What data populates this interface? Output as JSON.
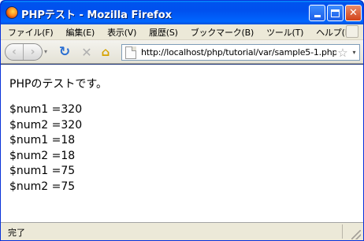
{
  "window": {
    "title": "PHPテスト - Mozilla Firefox",
    "minimize_glyph": "",
    "maximize_glyph": "",
    "close_glyph": "✕"
  },
  "menu": {
    "items": [
      "ファイル(F)",
      "編集(E)",
      "表示(V)",
      "履歴(S)",
      "ブックマーク(B)",
      "ツール(T)",
      "ヘルプ(H)"
    ]
  },
  "toolbar": {
    "back_glyph": "‹",
    "forward_glyph": "›",
    "history_drop_glyph": "▾",
    "reload_glyph": "↻",
    "stop_glyph": "✕",
    "home_glyph": "⌂",
    "url": "http://localhost/php/tutorial/var/sample5-1.php",
    "star_glyph": "☆",
    "url_drop_glyph": "▾"
  },
  "content": {
    "intro": "PHPのテストです。",
    "lines": [
      "$num1 =320",
      "$num2 =320",
      "$num1 =18",
      "$num2 =18",
      "$num1 =75",
      "$num2 =75"
    ]
  },
  "status": {
    "text": "完了"
  },
  "colors": {
    "titlebar": "#0053ee",
    "chrome": "#ece9d8",
    "content_bg": "#ffffff",
    "reload_icon": "#2b6fd2",
    "home_icon": "#d6a200"
  }
}
